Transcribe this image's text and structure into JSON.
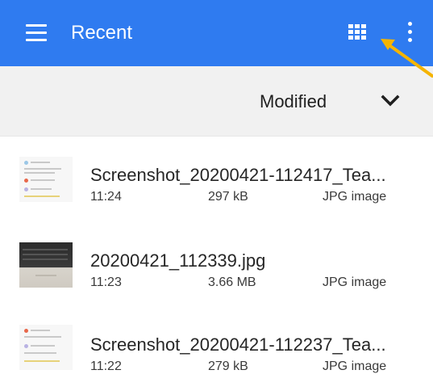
{
  "appbar": {
    "title": "Recent",
    "color": "#2f7bf0",
    "icons": [
      "menu-icon",
      "grid-view-icon",
      "more-vert-icon"
    ]
  },
  "sort": {
    "label": "Modified",
    "icon": "chevron-down-icon"
  },
  "files": [
    {
      "name": "Screenshot_20200421-112417_Tea...",
      "time": "11:24",
      "size": "297 kB",
      "type": "JPG image",
      "thumb": "screenshot"
    },
    {
      "name": "20200421_112339.jpg",
      "time": "11:23",
      "size": "3.66 MB",
      "type": "JPG image",
      "thumb": "photo"
    },
    {
      "name": "Screenshot_20200421-112237_Tea...",
      "time": "11:22",
      "size": "279 kB",
      "type": "JPG image",
      "thumb": "screenshot"
    }
  ],
  "annotation": {
    "arrow_color": "#f5b400",
    "arrow_icon": "annotation-arrow-icon"
  }
}
